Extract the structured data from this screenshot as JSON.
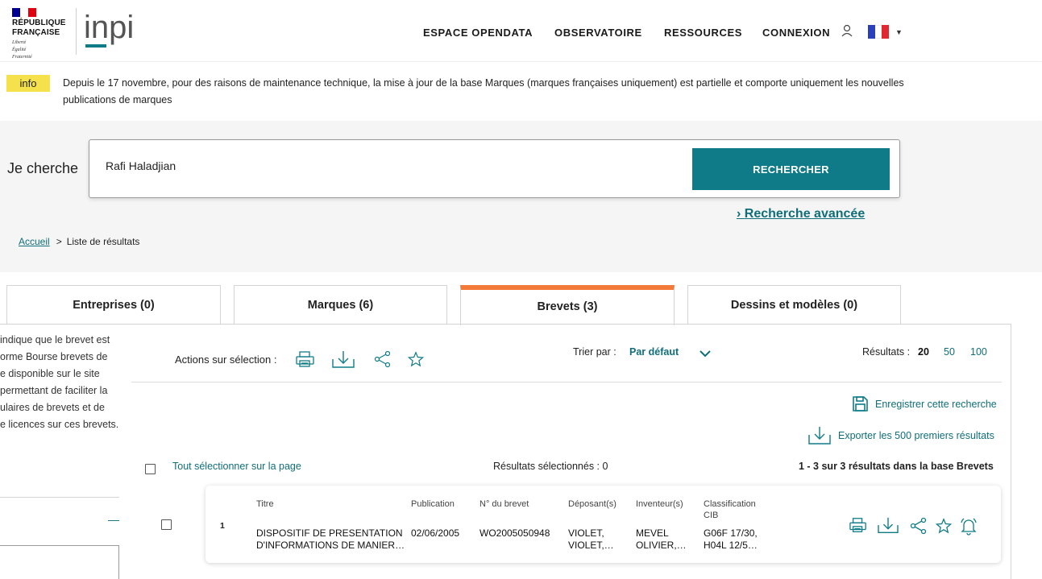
{
  "header": {
    "republic_lines": [
      "RÉPUBLIQUE",
      "FRANÇAISE"
    ],
    "motto_lines": [
      "Liberté",
      "Égalité",
      "Fraternité"
    ],
    "brand": "inpi",
    "nav": [
      {
        "label": "ESPACE OPENDATA"
      },
      {
        "label": "OBSERVATOIRE"
      },
      {
        "label": "RESSOURCES"
      },
      {
        "label": "CONNEXION"
      }
    ],
    "user_icon": "user-icon",
    "language_icon": "french-flag-icon",
    "colors": {
      "flag_blue": "#000091",
      "flag_red": "#e1000f",
      "brand_teal": "#0f7b88"
    }
  },
  "info": {
    "badge": "info",
    "text": "Depuis le 17 novembre, pour des raisons de maintenance technique, la mise à jour de la base Marques (marques françaises uniquement) est partielle et comporte uniquement les nouvelles publications de marques"
  },
  "search": {
    "label": "Je cherche",
    "value": "Rafi Haladjian",
    "button": "RECHERCHER",
    "advanced_link": "Recherche avancée"
  },
  "breadcrumb": {
    "home": "Accueil",
    "separator": ">",
    "current": "Liste de résultats"
  },
  "tabs": [
    {
      "label": "Entreprises (0)"
    },
    {
      "label": "Marques (6)"
    },
    {
      "label": "Brevets (3)",
      "active": true
    },
    {
      "label": "Dessins et modèles (0)"
    }
  ],
  "sidebar_text": "Un indique que le brevet est plateforme Bourse brevets de disponible disponible sur le site permettant de faciliter la titulaires de brevets et de de licences sur ces brevets.",
  "sidebar_lines": [
    "indique que le brevet est",
    "orme Bourse brevets de",
    "e disponible sur le site",
    "permettant de faciliter la",
    "ulaires de brevets et de",
    "e licences sur ces brevets."
  ],
  "sidebar_dash": "—",
  "actions": {
    "label": "Actions sur sélection :",
    "icons": [
      "print-icon",
      "download-icon",
      "share-icon",
      "star-icon"
    ],
    "sort_label": "Trier par :",
    "sort_value": "Par défaut",
    "results_label": "Résultats :",
    "results_options": [
      "20",
      "50",
      "100"
    ],
    "results_selected": "20",
    "save_search": "Enregistrer cette recherche",
    "export": "Exporter les 500 premiers résultats",
    "select_all": "Tout sélectionner sur la page",
    "selected_count": "Résultats sélectionnés : 0",
    "summary": "1 - 3 sur 3 résultats dans la base Brevets"
  },
  "results": [
    {
      "index": "1",
      "headers": {
        "titre": "Titre",
        "publication": "Publication",
        "numero": "N° du brevet",
        "deposants": "Déposant(s)",
        "inventeurs": "Inventeur(s)",
        "classification": "Classification CIB"
      },
      "titre": [
        "DISPOSITIF DE PRESENTATION",
        "D'INFORMATIONS DE MANIER…"
      ],
      "publication": "02/06/2005",
      "numero": "WO2005050948",
      "deposants": [
        "VIOLET,",
        "VIOLET,…"
      ],
      "inventeurs": [
        "MEVEL",
        "OLIVIER,…"
      ],
      "classification": [
        "G06F 17/30,",
        "H04L 12/5…"
      ],
      "icons": [
        "print-icon",
        "download-icon",
        "share-icon",
        "star-icon",
        "alert-bell-icon"
      ]
    }
  ]
}
